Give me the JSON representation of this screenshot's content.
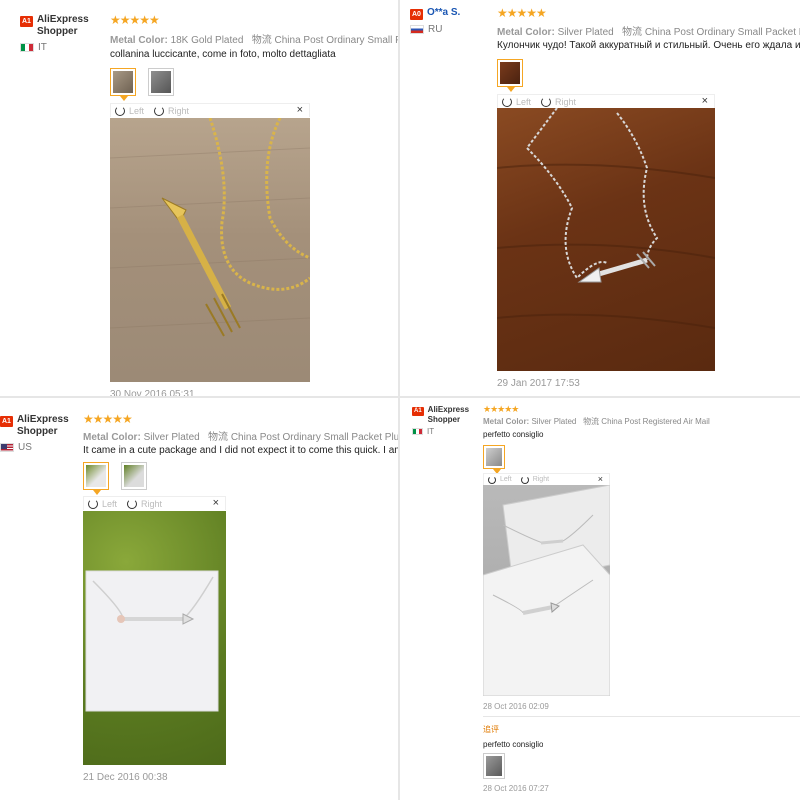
{
  "reviews": [
    {
      "level": "A1",
      "user": "AliExpress Shopper",
      "country": "IT",
      "rating": "★★★★★",
      "meta_label": "Metal Color:",
      "meta_value": "18K Gold Plated",
      "shipping_label": "物流",
      "shipping_value": "China Post Ordinary Small Pa",
      "text": "collanina luccicante, come in foto, molto dettagliata",
      "left_label": "Left",
      "right_label": "Right",
      "close": "×",
      "date": "30 Nov 2016 05:31"
    },
    {
      "level": "A0",
      "user": "O**a S.",
      "country": "RU",
      "rating": "★★★★★",
      "meta_label": "Metal Color:",
      "meta_value": "Silver Plated",
      "shipping_label": "物流",
      "shipping_value": "China Post Ordinary Small Packet Pl",
      "text": "Кулончик чудо! Такой аккуратный и стильный. Очень его ждала и",
      "left_label": "Left",
      "right_label": "Right",
      "close": "×",
      "date": "29 Jan 2017 17:53"
    },
    {
      "level": "A1",
      "user": "AliExpress Shopper",
      "country": "US",
      "rating": "★★★★★",
      "meta_label": "Metal Color:",
      "meta_value": "Silver Plated",
      "shipping_label": "物流",
      "shipping_value": "China Post Ordinary Small Packet Plus",
      "text": "It came in a cute package and I did not expect it to come this quick. I am glad",
      "left_label": "Left",
      "right_label": "Right",
      "close": "×",
      "date": "21 Dec 2016 00:38"
    },
    {
      "level": "A1",
      "user": "AliExpress Shopper",
      "country": "IT",
      "rating": "★★★★★",
      "meta_label": "Metal Color:",
      "meta_value": "Silver Plated",
      "shipping_label": "物流",
      "shipping_value": "China Post Registered Air Mail",
      "text": "perfetto consiglio",
      "left_label": "Left",
      "right_label": "Right",
      "close": "×",
      "date": "28 Oct 2016 02:09",
      "followup_label": "追评",
      "followup_text": "perfetto consiglio",
      "followup_date": "28 Oct 2016 07:27"
    }
  ],
  "colors": {
    "accent": "#e62e04",
    "star": "#f5a623",
    "username_blue": "#1a56b3"
  }
}
